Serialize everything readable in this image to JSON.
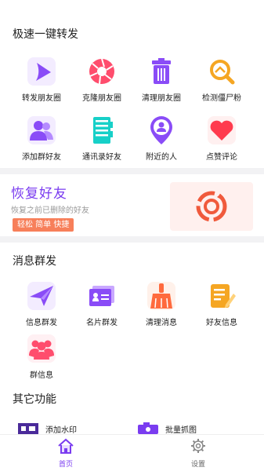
{
  "section_quick": {
    "title": "极速一键转发",
    "items": [
      {
        "label": "转发朋友圈",
        "icon": "play-icon"
      },
      {
        "label": "克隆朋友圈",
        "icon": "aperture-icon"
      },
      {
        "label": "清理朋友圈",
        "icon": "trash-icon"
      },
      {
        "label": "检测僵尸粉",
        "icon": "search-icon"
      },
      {
        "label": "添加群好友",
        "icon": "people-icon"
      },
      {
        "label": "通讯录好友",
        "icon": "contacts-book-icon"
      },
      {
        "label": "附近的人",
        "icon": "location-person-icon"
      },
      {
        "label": "点赞评论",
        "icon": "heart-icon"
      }
    ]
  },
  "banner": {
    "title": "恢复好友",
    "subtitle": "恢复之前已删除的好友",
    "tag": "轻松 简单 快捷"
  },
  "section_msg": {
    "title": "消息群发",
    "items": [
      {
        "label": "信息群发",
        "icon": "paper-plane-icon"
      },
      {
        "label": "名片群发",
        "icon": "card-icon"
      },
      {
        "label": "清理消息",
        "icon": "broom-icon"
      },
      {
        "label": "好友信息",
        "icon": "note-edit-icon"
      },
      {
        "label": "群信息",
        "icon": "group-icon"
      }
    ]
  },
  "section_other": {
    "title": "其它功能",
    "items": [
      {
        "label": "添加水印",
        "icon": "watermark-icon"
      },
      {
        "label": "批量抓图",
        "icon": "camera-icon"
      }
    ]
  },
  "tabbar": {
    "tabs": [
      {
        "label": "首页",
        "icon": "home-icon"
      },
      {
        "label": "设置",
        "icon": "gear-icon"
      }
    ]
  },
  "colors": {
    "accent": "#7a3cf0",
    "orange": "#f77f5a",
    "banner_bg": "#fff0ee"
  }
}
